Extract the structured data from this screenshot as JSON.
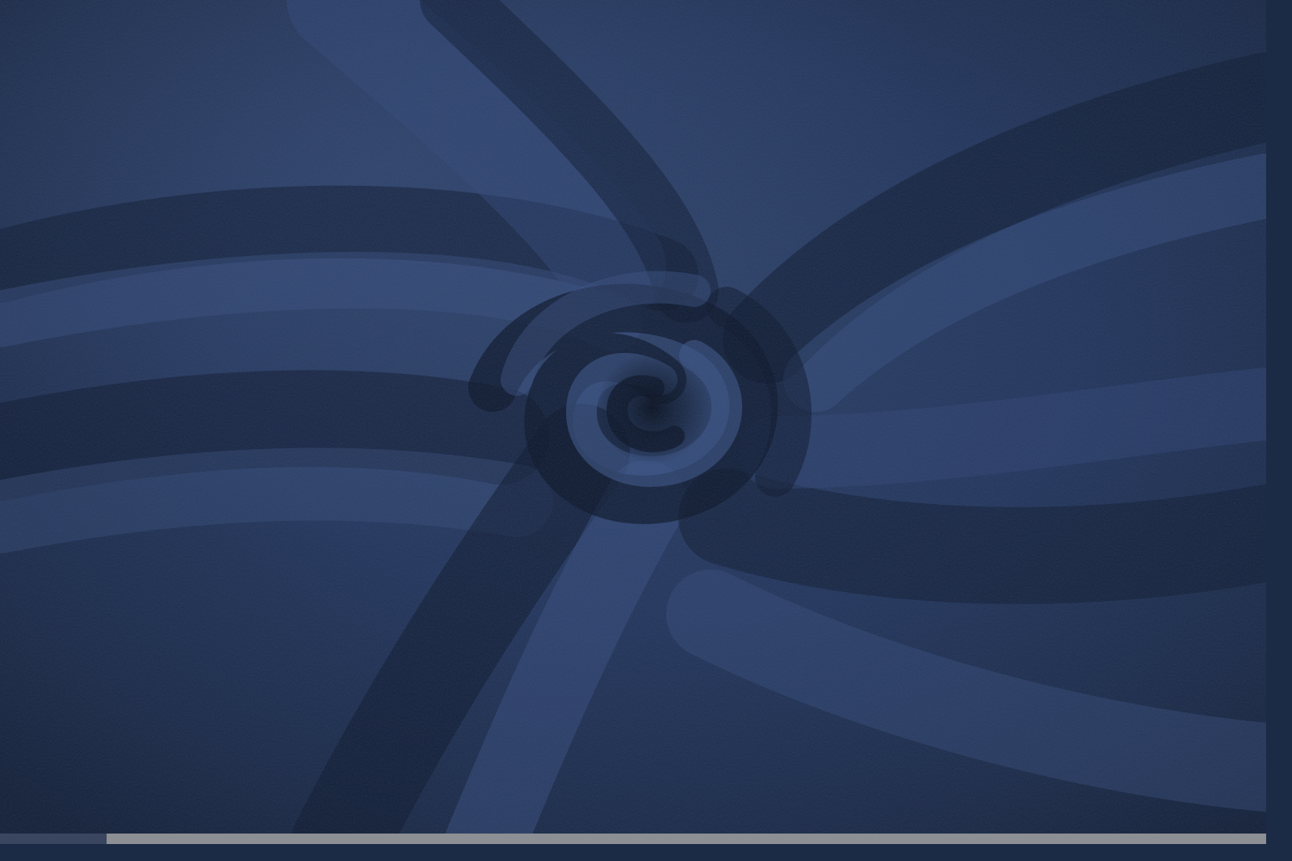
{
  "title": "",
  "colors": {
    "fabric_base": "#1f2f4f",
    "fabric_highlight": "#3b5382",
    "fabric_shadow": "#0d1628",
    "bottom_band": "#8c8f93",
    "bottom_band_dark": "#3a4660"
  },
  "subject": {
    "title": ""
  }
}
